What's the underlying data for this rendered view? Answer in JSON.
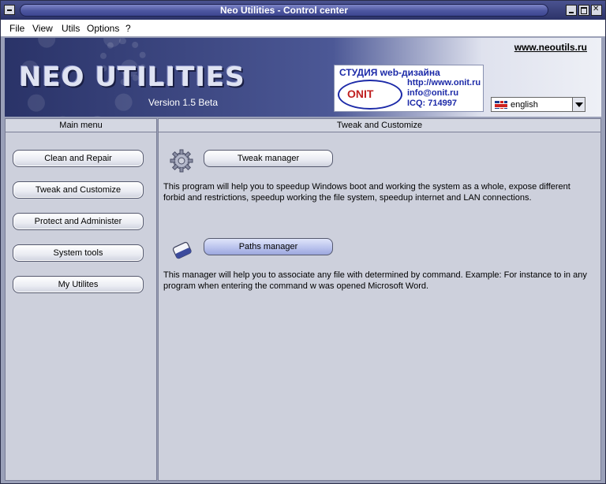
{
  "window": {
    "title": "Neo Utilities - Control center"
  },
  "menubar": {
    "items": [
      "File",
      "View",
      "Utils",
      "Options",
      "?"
    ]
  },
  "banner": {
    "logo_text": "NEO UTILITIES",
    "version": "Version 1.5 Beta",
    "site_link": "www.neoutils.ru",
    "ad": {
      "title": "СТУДИЯ web-дизайна",
      "logo_text": "ONIT",
      "url": "http://www.onit.ru",
      "email": "info@onit.ru",
      "icq": "ICQ: 714997"
    },
    "language": {
      "selected": "english",
      "flag_icon": "uk-flag-icon"
    }
  },
  "left_panel": {
    "header": "Main menu",
    "buttons": [
      "Clean and Repair",
      "Tweak and Customize",
      "Protect and Administer",
      "System tools",
      "My Utilites"
    ]
  },
  "right_panel": {
    "header": "Tweak and Customize",
    "tools": [
      {
        "icon": "gear-icon",
        "label": "Tweak manager",
        "description": "This program will help you to speedup Windows boot and working the system as a whole, expose different forbid and restrictions, speedup working the file system, speedup internet and LAN connections."
      },
      {
        "icon": "paths-icon",
        "label": "Paths manager",
        "description": "This manager will help you to associate any file with determined by command. Example: For instance to in any program when entering the command w was opened Microsoft Word."
      }
    ]
  },
  "colors": {
    "window_bg": "#9aa0b8",
    "panel_bg": "#cdd0dc",
    "title_accent": "#4d56a0",
    "active_button": "#b7c0ec"
  }
}
